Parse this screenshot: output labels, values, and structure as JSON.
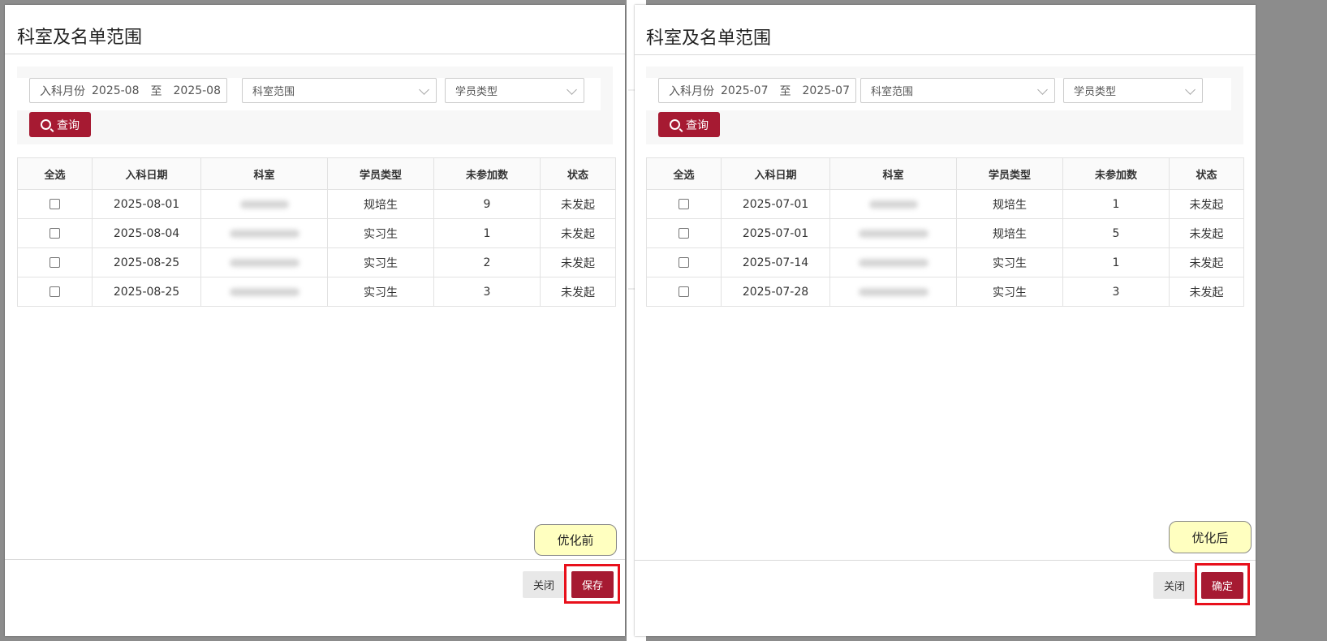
{
  "left": {
    "title": "科室及名单范围",
    "month_label": "入科月份",
    "month_from": "2025-08",
    "month_sep": "至",
    "month_to": "2025-08",
    "dept_placeholder": "科室范围",
    "type_placeholder": "学员类型",
    "query_label": "查询",
    "headers": [
      "全选",
      "入科日期",
      "科室",
      "学员类型",
      "未参加数",
      "状态"
    ],
    "rows": [
      {
        "date": "2025-08-01",
        "type": "规培生",
        "count": "9",
        "status": "未发起"
      },
      {
        "date": "2025-08-04",
        "type": "实习生",
        "count": "1",
        "status": "未发起"
      },
      {
        "date": "2025-08-25",
        "type": "实习生",
        "count": "2",
        "status": "未发起"
      },
      {
        "date": "2025-08-25",
        "type": "实习生",
        "count": "3",
        "status": "未发起"
      }
    ],
    "close_label": "关闭",
    "primary_label": "保存",
    "note": "优化前"
  },
  "right": {
    "title": "科室及名单范围",
    "month_label": "入科月份",
    "month_from": "2025-07",
    "month_sep": "至",
    "month_to": "2025-07",
    "dept_placeholder": "科室范围",
    "type_placeholder": "学员类型",
    "query_label": "查询",
    "headers": [
      "全选",
      "入科日期",
      "科室",
      "学员类型",
      "未参加数",
      "状态"
    ],
    "rows": [
      {
        "date": "2025-07-01",
        "type": "规培生",
        "count": "1",
        "status": "未发起"
      },
      {
        "date": "2025-07-01",
        "type": "规培生",
        "count": "5",
        "status": "未发起"
      },
      {
        "date": "2025-07-14",
        "type": "实习生",
        "count": "1",
        "status": "未发起"
      },
      {
        "date": "2025-07-28",
        "type": "实习生",
        "count": "3",
        "status": "未发起"
      }
    ],
    "close_label": "关闭",
    "primary_label": "确定",
    "note": "优化后"
  },
  "colors": {
    "primary": "#a61a32",
    "highlight": "#e8101b",
    "note_bg": "#ffffc0"
  }
}
